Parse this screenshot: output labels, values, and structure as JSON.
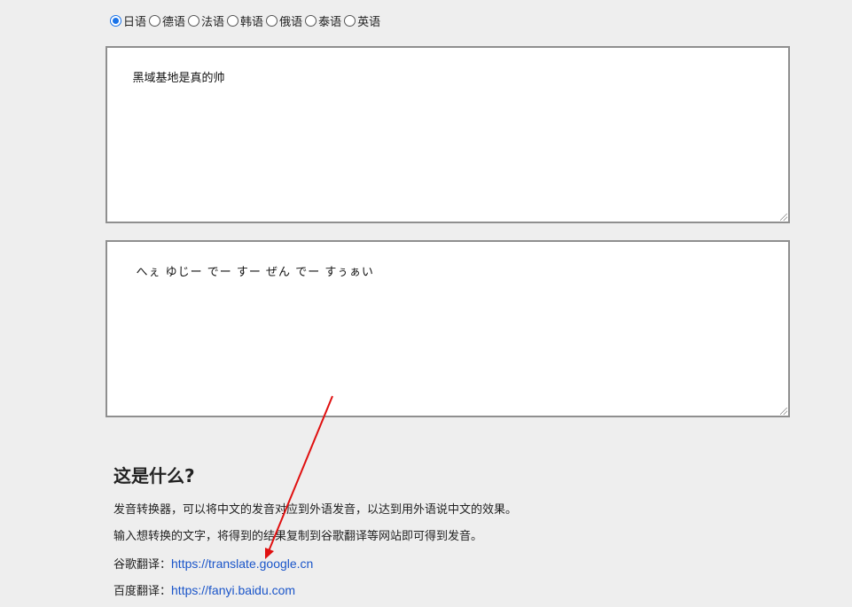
{
  "languages": [
    {
      "label": "日语",
      "checked": true
    },
    {
      "label": "德语",
      "checked": false
    },
    {
      "label": "法语",
      "checked": false
    },
    {
      "label": "韩语",
      "checked": false
    },
    {
      "label": "俄语",
      "checked": false
    },
    {
      "label": "泰语",
      "checked": false
    },
    {
      "label": "英语",
      "checked": false
    }
  ],
  "input_text": "黑域基地是真的帅",
  "output_text": "へぇ ゆじー でー すー ぜん でー すぅぁい",
  "about": {
    "heading": "这是什么?",
    "para1": "发音转换器，可以将中文的发音对应到外语发音，以达到用外语说中文的效果。",
    "para2": "输入想转换的文字，将得到的结果复制到谷歌翻译等网站即可得到发音。",
    "google_label": "谷歌翻译：",
    "google_url": "https://translate.google.cn",
    "baidu_label": "百度翻译：",
    "baidu_url": "https://fanyi.baidu.com"
  },
  "colors": {
    "background": "#eeeeee",
    "link": "#1a55c9",
    "radio_accent": "#1a73e8",
    "annotation_arrow": "#e01010"
  }
}
